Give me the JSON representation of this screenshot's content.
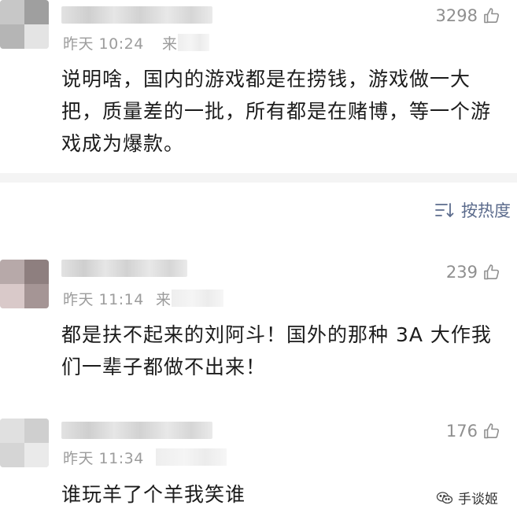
{
  "comments": [
    {
      "time": "昨天 10:24",
      "source_prefix": "来",
      "likes": "3298",
      "text": "说明啥，国内的游戏都是在捞钱，游戏做一大把，质量差的一批，所有都是在赌博，等一个游戏成为爆款。"
    },
    {
      "time": "昨天 11:14",
      "source_prefix": "来",
      "likes": "239",
      "text": "都是扶不起来的刘阿斗！国外的那种 3A 大作我们一辈子都做不出来！"
    },
    {
      "time": "昨天 11:34",
      "source_prefix": "",
      "likes": "176",
      "text": "谁玩羊了个羊我笑谁"
    }
  ],
  "sort": {
    "label": "按热度",
    "icon": "sort-icon"
  },
  "watermark": {
    "label": "手谈姬",
    "icon": "wechat-icon"
  },
  "colors": {
    "link_blue": "#5b6b8c",
    "meta_gray": "#9c9c9c",
    "divider": "#f4f4f4"
  }
}
